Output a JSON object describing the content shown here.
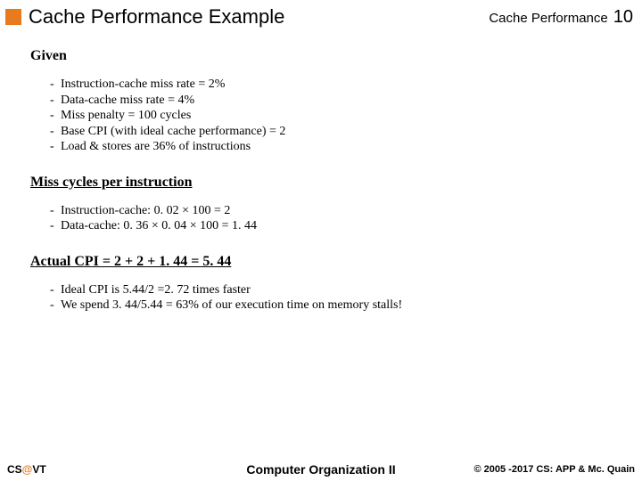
{
  "header": {
    "title": "Cache Performance Example",
    "topic": "Cache Performance",
    "page": "10"
  },
  "given": {
    "heading": "Given",
    "items": [
      "Instruction-cache miss rate = 2%",
      "Data-cache miss rate = 4%",
      "Miss penalty = 100 cycles",
      "Base CPI (with ideal cache performance) = 2",
      "Load & stores are 36% of instructions"
    ]
  },
  "miss": {
    "heading": "Miss cycles per instruction",
    "items": [
      "Instruction-cache: 0. 02 × 100 = 2",
      "Data-cache: 0. 36 × 0. 04 × 100 = 1. 44"
    ]
  },
  "actual": {
    "heading": "Actual CPI = 2 + 2 + 1. 44 = 5. 44",
    "items": [
      "Ideal CPI is 5.44/2 =2. 72 times faster",
      "We spend 3. 44/5.44 = 63% of our execution time on memory stalls!"
    ]
  },
  "footer": {
    "left_pre": "CS",
    "left_at": "@",
    "left_post": "VT",
    "center": "Computer Organization II",
    "right": "© 2005 -2017 CS: APP & Mc. Quain"
  }
}
